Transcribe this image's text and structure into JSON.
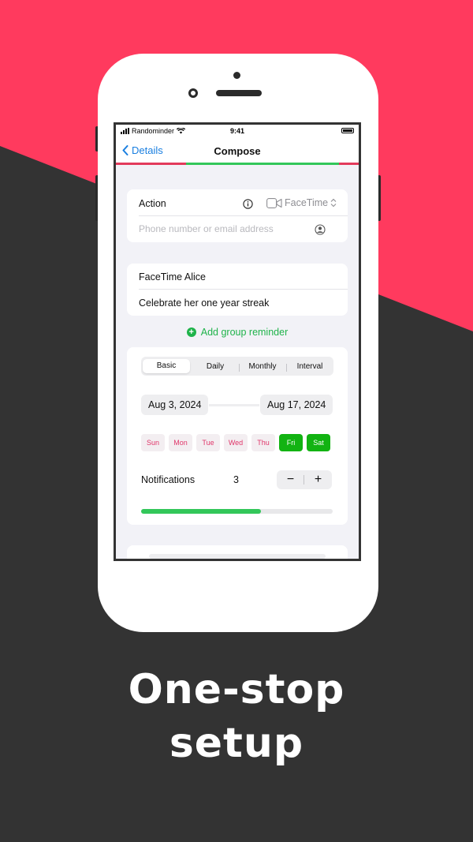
{
  "colors": {
    "accent_pink": "#ff3a5e",
    "dark_bg": "#333333",
    "green": "#12b312",
    "link_blue": "#1a7fe0"
  },
  "status_bar": {
    "carrier": "Randominder",
    "time": "9:41",
    "icons": [
      "cellular-bars-icon",
      "wifi-icon",
      "battery-icon"
    ]
  },
  "nav": {
    "back_label": "Details",
    "title": "Compose"
  },
  "action_card": {
    "label": "Action",
    "info_icon": "info-icon",
    "service": "FaceTime",
    "service_icon": "video-camera-icon",
    "contact_placeholder": "Phone number or email address",
    "contact_icon": "person-circle-icon"
  },
  "message_card": {
    "title": "FaceTime Alice",
    "body": "Celebrate her one year streak"
  },
  "add_group_label": "Add group reminder",
  "schedule": {
    "tabs": [
      "Basic",
      "Daily",
      "Monthly",
      "Interval"
    ],
    "selected_tab": "Basic",
    "start_date": "Aug 3, 2024",
    "end_date": "Aug 17, 2024",
    "days": [
      {
        "label": "Sun",
        "selected": false
      },
      {
        "label": "Mon",
        "selected": false
      },
      {
        "label": "Tue",
        "selected": false
      },
      {
        "label": "Wed",
        "selected": false
      },
      {
        "label": "Thu",
        "selected": false
      },
      {
        "label": "Fri",
        "selected": true
      },
      {
        "label": "Sat",
        "selected": true
      }
    ],
    "notifications_label": "Notifications",
    "notifications_value": "3",
    "stepper_minus": "−",
    "stepper_plus": "+",
    "progress_fraction": 0.625
  },
  "headline": {
    "line1": "One-stop",
    "line2": "setup"
  }
}
